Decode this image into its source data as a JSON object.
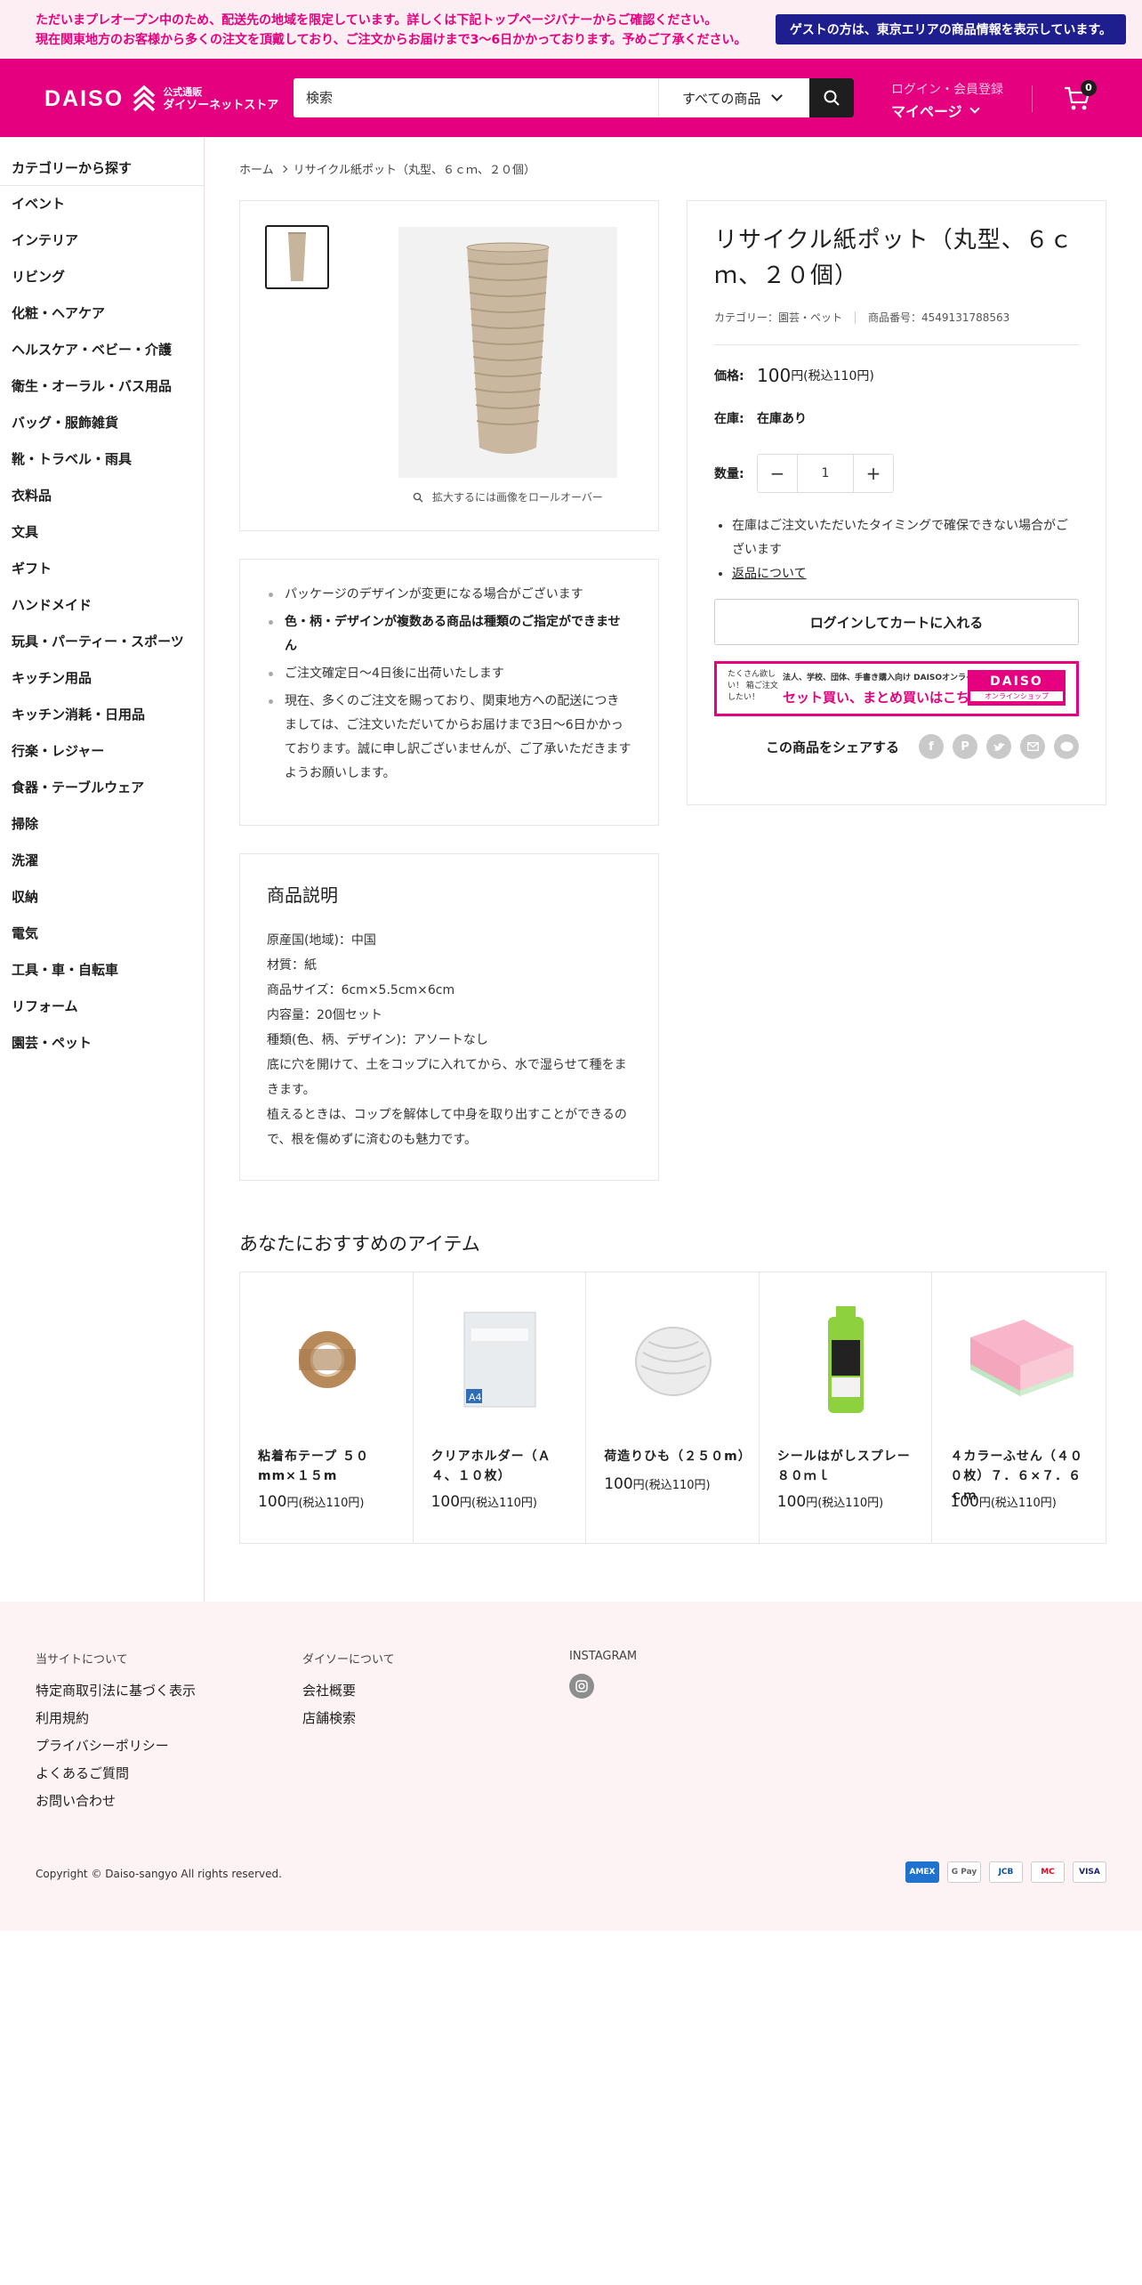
{
  "notice": {
    "line1": "ただいまプレオープン中のため、配送先の地域を限定しています。詳しくは下記トップページバナーからご確認ください。",
    "line2": "現在関東地方のお客様から多くの注文を頂戴しており、ご注文からお届けまで3〜6日かかっております。予めご了承ください。",
    "guest_button": "ゲストの方は、東京エリアの商品情報を表示しています。"
  },
  "header": {
    "logo_word": "DAISO",
    "logo_sub1": "公式通販",
    "logo_sub2": "ダイソーネットストア",
    "search_placeholder": "検索",
    "search_category": "すべての商品",
    "account_small": "ログイン・会員登録",
    "account_big": "マイページ",
    "cart_count": "0",
    "brand_color": "#e4007f"
  },
  "sidebar": {
    "title": "カテゴリーから探す",
    "items": [
      "イベント",
      "インテリア",
      "リビング",
      "化粧・ヘアケア",
      "ヘルスケア・ベビー・介護",
      "衛生・オーラル・バス用品",
      "バッグ・服飾雑貨",
      "靴・トラベル・雨具",
      "衣料品",
      "文具",
      "ギフト",
      "ハンドメイド",
      "玩具・パーティー・スポーツ",
      "キッチン用品",
      "キッチン消耗・日用品",
      "行楽・レジャー",
      "食器・テーブルウェア",
      "掃除",
      "洗濯",
      "収納",
      "電気",
      "工具・車・自転車",
      "リフォーム",
      "園芸・ペット"
    ]
  },
  "breadcrumb": {
    "home": "ホーム",
    "current": "リサイクル紙ポット（丸型、６ｃｍ、２０個）"
  },
  "gallery": {
    "zoom_hint": "拡大するには画像をロールオーバー"
  },
  "notes": [
    "パッケージのデザインが変更になる場合がございます",
    "色・柄・デザインが複数ある商品は種類のご指定ができません",
    "ご注文確定日〜4日後に出荷いたします",
    "現在、多くのご注文を賜っており、関東地方への配送につきましては、ご注文いただいてからお届けまで3日～6日かかっております。誠に申し訳ございませんが、ご了承いただきますようお願いします。"
  ],
  "description": {
    "title": "商品説明",
    "lines": [
      "原産国(地域)：中国",
      "材質：紙",
      "商品サイズ：6cm×5.5cm×6cm",
      "内容量：20個セット",
      "種類(色、柄、デザイン)：アソートなし",
      "底に穴を開けて、土をコップに入れてから、水で湿らせて種をまきます。",
      "植えるときは、コップを解体して中身を取り出すことができるので、根を傷めずに済むのも魅力です。"
    ]
  },
  "product": {
    "title": "リサイクル紙ポット（丸型、６ｃｍ、２０個）",
    "category": "カテゴリー：園芸・ペット",
    "sku": "商品番号：4549131788563",
    "price_label": "価格:",
    "price": "100",
    "price_unit": "円(税込110円)",
    "stock_label": "在庫:",
    "stock_value": "在庫あり",
    "qty_label": "数量:",
    "qty_value": "1",
    "bullet1": "在庫はご注文いただいたタイミングで確保できない場合がございます",
    "bullet2": "返品について",
    "cart_button": "ログインしてカートに入れる",
    "banner_small1": "たくさん欲しい！ 箱ご注文したい！",
    "banner_small2": "法人、学校、団体、手書き購入向け DAISOオンラインショップ",
    "banner_main": "セット買い、まとめ買いはこちら",
    "banner_logo": "DAISO",
    "banner_logo_sub": "オンラインショップ",
    "share_label": "この商品をシェアする"
  },
  "recommend": {
    "title": "あなたにおすすめのアイテム",
    "items": [
      {
        "name": "粘着布テープ ５０mm×１５m",
        "price": "100",
        "unit": "円(税込110円)"
      },
      {
        "name": "クリアホルダー（Ａ４、１０枚）",
        "price": "100",
        "unit": "円(税込110円)"
      },
      {
        "name": "荷造りひも（２５０m）",
        "price": "100",
        "unit": "円(税込110円)"
      },
      {
        "name": "シールはがしスプレー ８０ｍｌ",
        "price": "100",
        "unit": "円(税込110円)"
      },
      {
        "name": "４カラーふせん（４００枚）７．６×７．６ｃｍ",
        "price": "100",
        "unit": "円(税込110円)"
      }
    ]
  },
  "footer": {
    "col1_title": "当サイトについて",
    "col1_links": [
      "特定商取引法に基づく表示",
      "利用規約",
      "プライバシーポリシー",
      "よくあるご質問",
      "お問い合わせ"
    ],
    "col2_title": "ダイソーについて",
    "col2_links": [
      "会社概要",
      "店舗検索"
    ],
    "col3_title": "INSTAGRAM",
    "copyright": "Copyright © Daiso-sangyo All rights reserved.",
    "payments": [
      "AMEX",
      "G Pay",
      "JCB",
      "MC",
      "VISA"
    ]
  }
}
